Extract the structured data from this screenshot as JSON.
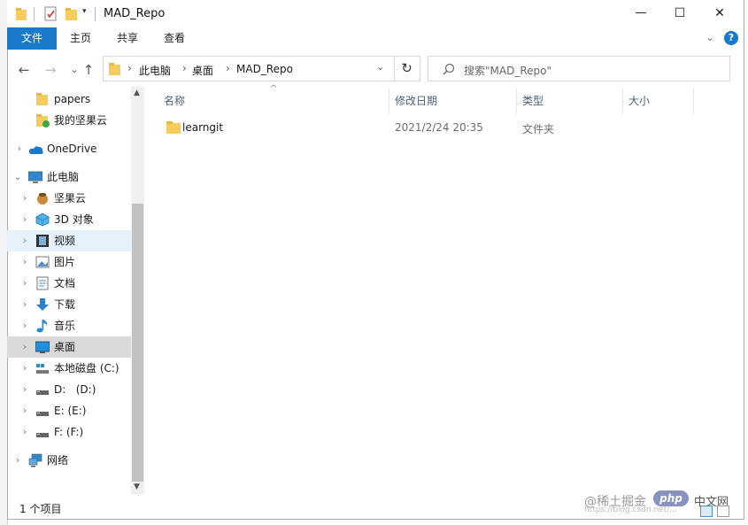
{
  "window": {
    "title": "MAD_Repo",
    "min_glyph": "—",
    "max_glyph": "☐",
    "close_glyph": "✕"
  },
  "ribbon": {
    "tabs": [
      "文件",
      "主页",
      "共享",
      "查看"
    ],
    "help_glyph": "?"
  },
  "navigation": {
    "back_glyph": "←",
    "forward_glyph": "→",
    "recent_glyph": "⌄",
    "up_glyph": "↑",
    "breadcrumb": [
      "此电脑",
      "桌面",
      "MAD_Repo"
    ],
    "separator": "›",
    "refresh_glyph": "↻",
    "search_placeholder": "搜索\"MAD_Repo\""
  },
  "sidebar": {
    "items": [
      {
        "label": "papers",
        "icon": "folder-icon"
      },
      {
        "label": "我的坚果云",
        "icon": "nutstore-folder-icon"
      },
      {
        "label": "OneDrive",
        "icon": "cloud-icon"
      },
      {
        "label": "此电脑",
        "icon": "computer-icon"
      },
      {
        "label": "坚果云",
        "icon": "nutstore-icon"
      },
      {
        "label": "3D 对象",
        "icon": "3d-objects-icon"
      },
      {
        "label": "视频",
        "icon": "video-icon"
      },
      {
        "label": "图片",
        "icon": "pictures-icon"
      },
      {
        "label": "文档",
        "icon": "documents-icon"
      },
      {
        "label": "下载",
        "icon": "download-icon"
      },
      {
        "label": "音乐",
        "icon": "music-icon"
      },
      {
        "label": "桌面",
        "icon": "desktop-icon"
      },
      {
        "label": "本地磁盘 (C:)",
        "icon": "disk-c-icon"
      },
      {
        "label": "D:   (D:)",
        "icon": "drive-icon"
      },
      {
        "label": "E: (E:)",
        "icon": "drive-icon"
      },
      {
        "label": "F: (F:)",
        "icon": "drive-icon"
      },
      {
        "label": "网络",
        "icon": "network-icon"
      }
    ]
  },
  "columns": {
    "name": "名称",
    "modified": "修改日期",
    "type": "类型",
    "size": "大小"
  },
  "files": [
    {
      "name": "learngit",
      "modified": "2021/2/24 20:35",
      "type": "文件夹",
      "size": ""
    }
  ],
  "status": {
    "count": "1 个项目"
  },
  "watermark": {
    "text": "@稀土掘金",
    "logo_text": "php",
    "site": "中文网",
    "url": "https://blog.csdn.net/..."
  },
  "colors": {
    "accent": "#1979ca",
    "folder": "#f6cd5c",
    "selected": "#d9d9d9",
    "hover": "#e5f1fb"
  }
}
